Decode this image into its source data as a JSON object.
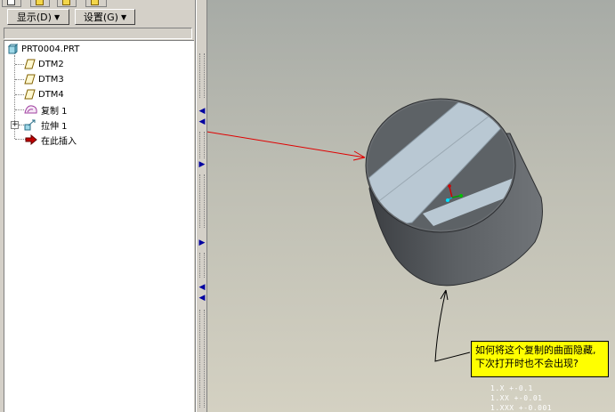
{
  "toolbar": {
    "show_label": "显示(D)",
    "settings_label": "设置(G)"
  },
  "model_tree": {
    "root": "PRT0004.PRT",
    "items": [
      {
        "label": "DTM2",
        "icon": "datum-plane-icon"
      },
      {
        "label": "DTM3",
        "icon": "datum-plane-icon"
      },
      {
        "label": "DTM4",
        "icon": "datum-plane-icon"
      },
      {
        "label": "复制 1",
        "icon": "copy-surface-icon"
      },
      {
        "label": "拉伸 1",
        "icon": "extrude-icon"
      },
      {
        "label": "在此插入",
        "icon": "insert-here-arrow-icon"
      }
    ]
  },
  "viewport": {
    "callout_text": "如何将这个复制的曲面隐藏,下次打开时也不会出现?",
    "accuracy_lines": [
      "1.X  +-0.1",
      "1.XX  +-0.01",
      "1.XXX +-0.001"
    ]
  },
  "colors": {
    "callout_bg": "#ffff00",
    "arrow_red": "#e00000",
    "cylinder_dark": "#4a4d51",
    "cap_face": "#b9c8d3"
  }
}
